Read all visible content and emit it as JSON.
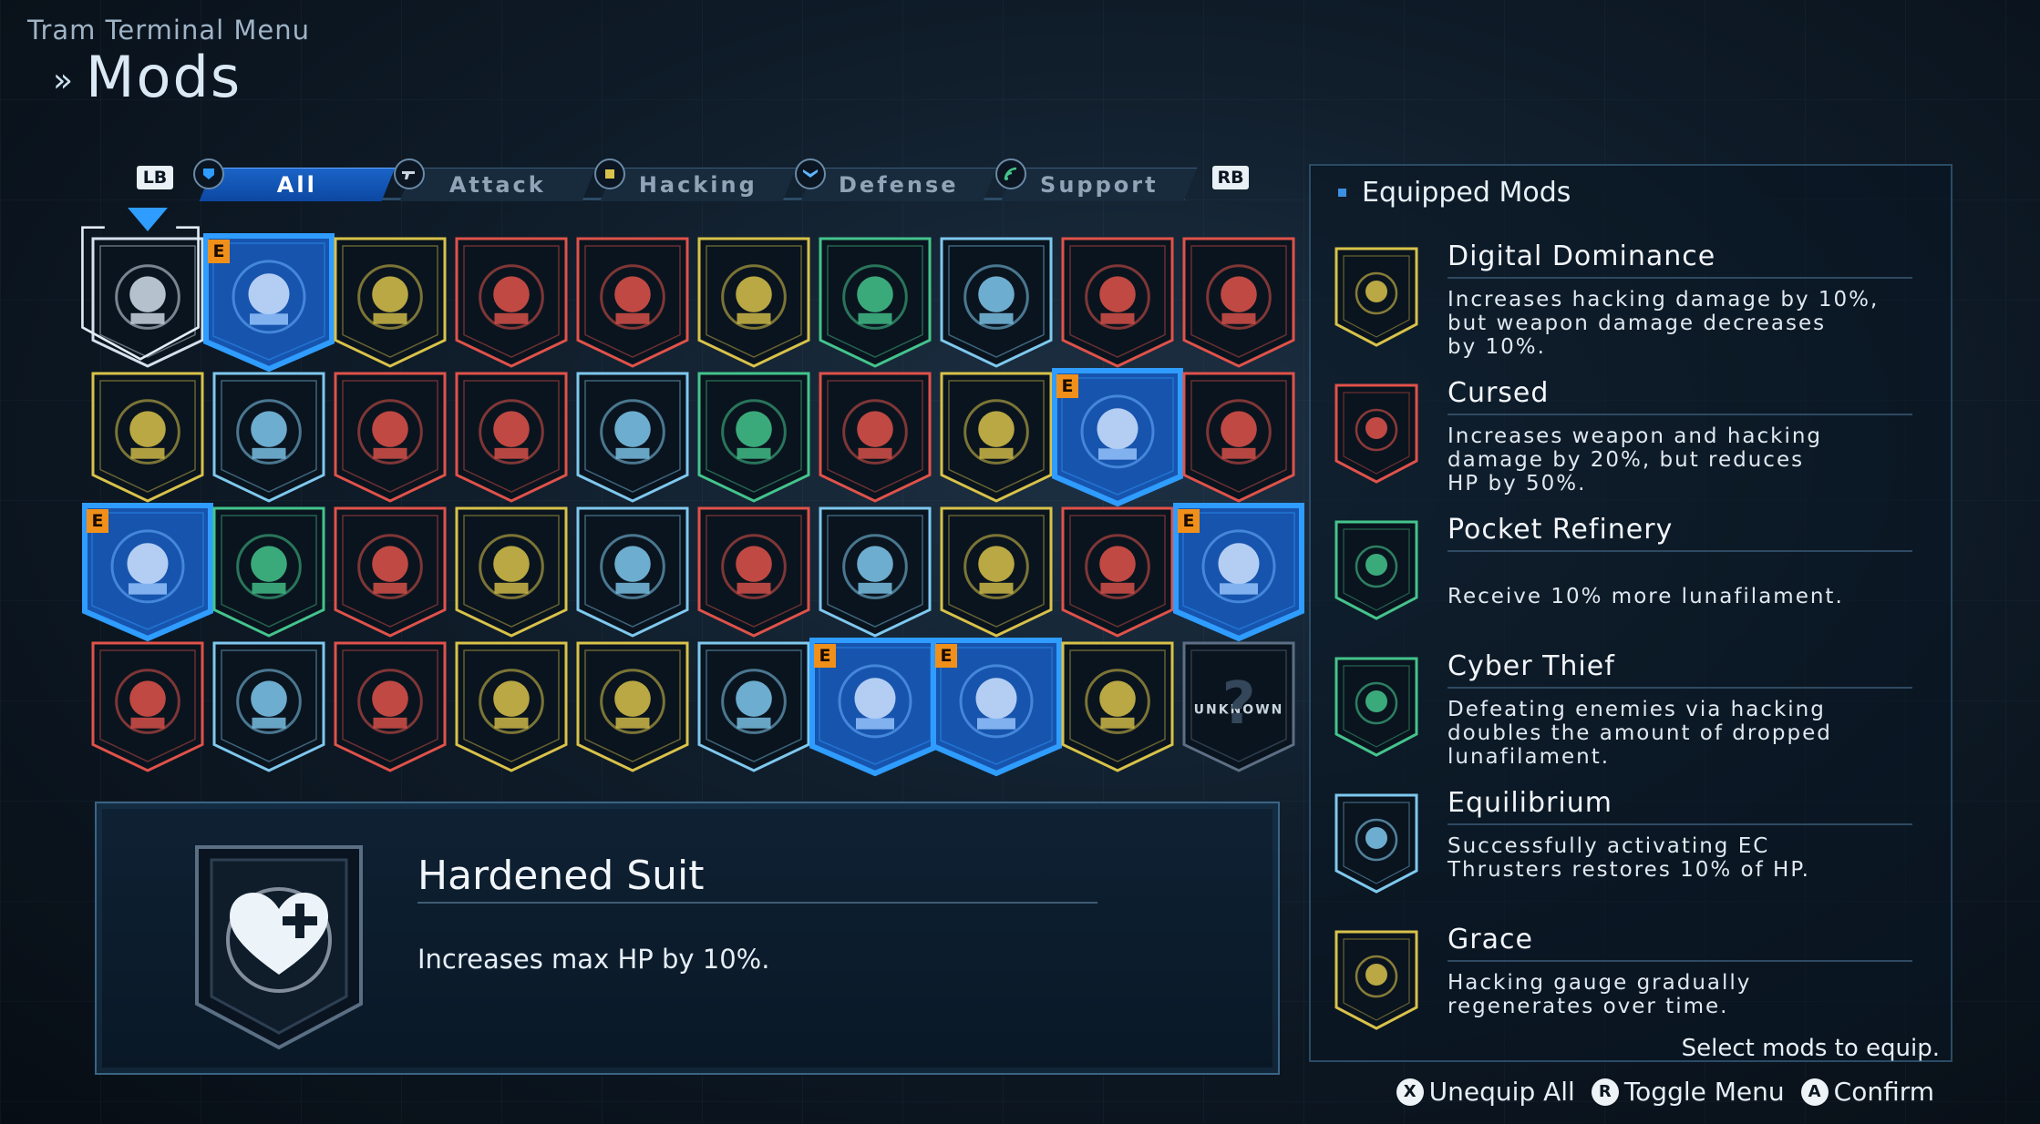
{
  "header": {
    "menu_label": "Tram Terminal Menu",
    "title": "Mods",
    "chevron": "»"
  },
  "tabs": {
    "left_button": "LB",
    "right_button": "RB",
    "items": [
      {
        "label": "All",
        "icon": "all-icon",
        "active": true
      },
      {
        "label": "Attack",
        "icon": "gun-icon",
        "active": false
      },
      {
        "label": "Hacking",
        "icon": "chip-icon",
        "active": false
      },
      {
        "label": "Defense",
        "icon": "shield-icon",
        "active": false
      },
      {
        "label": "Support",
        "icon": "signal-icon",
        "active": false
      }
    ]
  },
  "grid": {
    "rows": [
      [
        {
          "color": "#d4e0ec",
          "icon": "heart-plus-icon",
          "selected": true
        },
        {
          "color": "#6ab0ff",
          "icon": "refinery-icon",
          "equipped": true
        },
        {
          "color": "#d8c24a",
          "icon": "figure-timer-icon"
        },
        {
          "color": "#e0524a",
          "icon": "fist-punch-icon"
        },
        {
          "color": "#e0524a",
          "icon": "target-icon"
        },
        {
          "color": "#d8c24a",
          "icon": "hand-figure-icon"
        },
        {
          "color": "#44c48c",
          "icon": "cycle-icon"
        },
        {
          "color": "#7fc8ee",
          "icon": "figure-shield-icon"
        },
        {
          "color": "#e0524a",
          "icon": "burst-icon"
        },
        {
          "color": "#e0524a",
          "icon": "burst-figure-icon"
        }
      ],
      [
        {
          "color": "#d8c24a",
          "icon": "ring-icon"
        },
        {
          "color": "#7fc8ee",
          "icon": "drone-gun-icon"
        },
        {
          "color": "#e0524a",
          "icon": "brawl-icon"
        },
        {
          "color": "#e0524a",
          "icon": "kick-icon"
        },
        {
          "color": "#7fc8ee",
          "icon": "astronaut-icon"
        },
        {
          "color": "#44c48c",
          "icon": "shield-grid-icon"
        },
        {
          "color": "#e0524a",
          "icon": "gunner-icon"
        },
        {
          "color": "#d8c24a",
          "icon": "grid-boost-icon"
        },
        {
          "color": "#6ab0ff",
          "icon": "thruster-heart-icon",
          "equipped": true
        },
        {
          "color": "#e0524a",
          "icon": "gun-grid-icon"
        }
      ],
      [
        {
          "color": "#6ab0ff",
          "icon": "digital-dominance-icon",
          "equipped": true
        },
        {
          "color": "#44c48c",
          "icon": "hacker-icon"
        },
        {
          "color": "#e0524a",
          "icon": "strike-icon"
        },
        {
          "color": "#d8c24a",
          "icon": "jump-icon"
        },
        {
          "color": "#7fc8ee",
          "icon": "cylinder-icon"
        },
        {
          "color": "#e0524a",
          "icon": "bullet-icon"
        },
        {
          "color": "#7fc8ee",
          "icon": "flex-icon"
        },
        {
          "color": "#d8c24a",
          "icon": "torso-icon"
        },
        {
          "color": "#e0524a",
          "icon": "slide-icon"
        },
        {
          "color": "#6ab0ff",
          "icon": "cursed-icon",
          "equipped": true
        }
      ],
      [
        {
          "color": "#e0524a",
          "icon": "tough-icon"
        },
        {
          "color": "#7fc8ee",
          "icon": "float-timer-icon"
        },
        {
          "color": "#e0524a",
          "icon": "skull-robot-icon"
        },
        {
          "color": "#d8c24a",
          "icon": "dome-icon"
        },
        {
          "color": "#d8c24a",
          "icon": "shell-icon"
        },
        {
          "color": "#7fc8ee",
          "icon": "shield-check-icon"
        },
        {
          "color": "#6ab0ff",
          "icon": "cyber-thief-icon",
          "equipped": true
        },
        {
          "color": "#6ab0ff",
          "icon": "grace-icon",
          "equipped": true
        },
        {
          "color": "#d8c24a",
          "icon": "clock-icon"
        },
        {
          "color": "#5d6f84",
          "icon": "unknown-icon",
          "unknown": true,
          "label": "UNKNOWN"
        }
      ]
    ],
    "equipped_badge": "E"
  },
  "detail": {
    "name": "Hardened Suit",
    "description": "Increases max HP by 10%."
  },
  "equipped": {
    "title": "Equipped Mods",
    "items": [
      {
        "name": "Digital Dominance",
        "desc": "Increases hacking damage by 10%,\nbut weapon damage decreases\nby 10%.",
        "color": "#d8c24a"
      },
      {
        "name": "Cursed",
        "desc": "Increases weapon and hacking\ndamage by 20%, but reduces\nHP by 50%.",
        "color": "#e0524a"
      },
      {
        "name": "Pocket Refinery",
        "desc": "\nReceive 10% more lunafilament.",
        "color": "#44c48c"
      },
      {
        "name": "Cyber Thief",
        "desc": "Defeating enemies via hacking\ndoubles the amount of dropped\nlunafilament.",
        "color": "#44c48c"
      },
      {
        "name": "Equilibrium",
        "desc": "Successfully activating EC\nThrusters restores 10% of HP.",
        "color": "#7fc8ee"
      },
      {
        "name": "Grace",
        "desc": "Hacking gauge gradually\nregenerates over time.",
        "color": "#d8c24a"
      }
    ]
  },
  "footer": {
    "hint": "Select mods to equip.",
    "unequip_key": "X",
    "unequip_label": "Unequip All",
    "toggle_key": "R",
    "toggle_label": "Toggle Menu",
    "confirm_key": "A",
    "confirm_label": "Confirm"
  }
}
